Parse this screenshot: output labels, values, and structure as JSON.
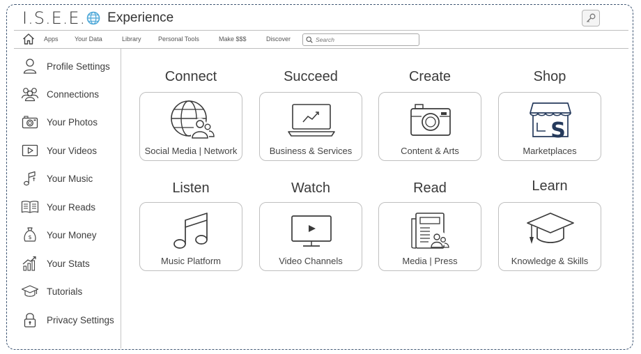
{
  "brand": {
    "name": "I.S.E.E.",
    "subtitle": "Experience"
  },
  "nav": {
    "items": [
      "Apps",
      "Your Data",
      "Library",
      "Personal Tools",
      "Make $$$",
      "Discover"
    ],
    "search_placeholder": "Search"
  },
  "sidebar": {
    "items": [
      {
        "label": "Profile Settings",
        "icon": "person-icon"
      },
      {
        "label": "Connections",
        "icon": "group-icon"
      },
      {
        "label": "Your Photos",
        "icon": "camera-icon"
      },
      {
        "label": "Your Videos",
        "icon": "video-icon"
      },
      {
        "label": "Your Music",
        "icon": "music-icon"
      },
      {
        "label": "Your Reads",
        "icon": "book-icon"
      },
      {
        "label": "Your Money",
        "icon": "money-bag-icon"
      },
      {
        "label": "Your Stats",
        "icon": "stats-icon"
      },
      {
        "label": "Tutorials",
        "icon": "graduation-cap-icon"
      },
      {
        "label": "Privacy Settings",
        "icon": "lock-icon"
      }
    ]
  },
  "categories": [
    {
      "title": "Connect",
      "label": "Social Media | Network",
      "icon": "globe-people-icon"
    },
    {
      "title": "Succeed",
      "label": "Business & Services",
      "icon": "laptop-chart-icon"
    },
    {
      "title": "Create",
      "label": "Content & Arts",
      "icon": "camera-icon"
    },
    {
      "title": "Shop",
      "label": "Marketplaces",
      "icon": "storefront-icon"
    },
    {
      "title": "Listen",
      "label": "Music Platform",
      "icon": "music-notes-icon"
    },
    {
      "title": "Watch",
      "label": "Video Channels",
      "icon": "tv-play-icon"
    },
    {
      "title": "Read",
      "label": "Media | Press",
      "icon": "newspaper-icon"
    },
    {
      "title": "Learn",
      "label": "Knowledge & Skills",
      "icon": "graduation-cap-icon"
    }
  ],
  "colors": {
    "frame": "#3f5673",
    "globe_accent": "#4ea8d8",
    "icon_stroke": "#3a3a3a",
    "shop_accent": "#253a5c"
  }
}
